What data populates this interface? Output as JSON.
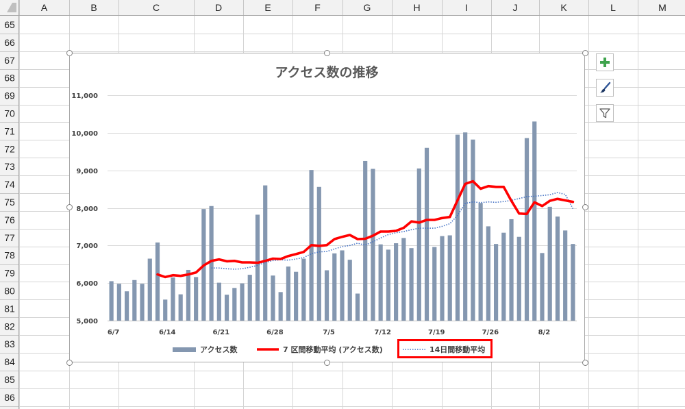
{
  "columns": [
    "A",
    "B",
    "C",
    "D",
    "E",
    "F",
    "G",
    "H",
    "I",
    "J",
    "K",
    "L",
    "M"
  ],
  "rows": [
    "65",
    "66",
    "67",
    "68",
    "69",
    "70",
    "71",
    "72",
    "73",
    "74",
    "75",
    "76",
    "77",
    "78",
    "79",
    "80",
    "81",
    "82",
    "83",
    "84",
    "85",
    "86"
  ],
  "side_buttons": [
    {
      "name": "chart-elements-button",
      "icon": "plus-icon",
      "color": "#3fa34d"
    },
    {
      "name": "chart-styles-button",
      "icon": "paintbrush-icon",
      "color": "#2f5597"
    },
    {
      "name": "chart-filters-button",
      "icon": "funnel-icon",
      "color": "#595959"
    }
  ],
  "chart_data": {
    "type": "bar",
    "title": "アクセス数の推移",
    "ylim": [
      5000,
      11000
    ],
    "yticks": [
      "5,000",
      "6,000",
      "7,000",
      "8,000",
      "9,000",
      "10,000",
      "11,000"
    ],
    "xtick_labels": [
      "6/7",
      "6/14",
      "6/21",
      "6/28",
      "7/5",
      "7/12",
      "7/19",
      "7/26",
      "8/2"
    ],
    "grid": true,
    "legend_position": "bottom",
    "colors": {
      "bars": "#8497b0",
      "ma7": "#ff0000",
      "ma14": "#4472c4",
      "highlight": "#ff0000"
    },
    "series": [
      {
        "name": "アクセス数",
        "type": "bar",
        "values": [
          6050,
          5980,
          5780,
          6080,
          5980,
          6650,
          7080,
          5560,
          6150,
          5700,
          6350,
          6160,
          7970,
          8050,
          6010,
          5690,
          5870,
          5990,
          6220,
          7820,
          8600,
          6200,
          5760,
          6440,
          6300,
          6650,
          9010,
          8560,
          6340,
          6790,
          6870,
          6620,
          5720,
          9250,
          9040,
          7030,
          6890,
          7060,
          7200,
          6930,
          9050,
          9600,
          6960,
          7250,
          7270,
          9950,
          10010,
          9820,
          8130,
          7510,
          7040,
          7340,
          7700,
          7230,
          9860,
          10300,
          6800,
          8030,
          7770,
          7400,
          7040
        ]
      },
      {
        "name": "7 区間移動平均 (アクセス数)",
        "type": "line",
        "style": "solid",
        "values": [
          null,
          null,
          null,
          null,
          null,
          null,
          6230,
          6160,
          6210,
          6190,
          6230,
          6280,
          6470,
          6590,
          6630,
          6580,
          6590,
          6550,
          6550,
          6540,
          6590,
          6650,
          6640,
          6720,
          6770,
          6830,
          7010,
          6990,
          7010,
          7170,
          7230,
          7280,
          7170,
          7180,
          7260,
          7370,
          7370,
          7390,
          7470,
          7640,
          7610,
          7680,
          7680,
          7730,
          7760,
          8200,
          8640,
          8710,
          8510,
          8580,
          8560,
          8560,
          8190,
          7850,
          7840,
          8150,
          8050,
          8190,
          8240,
          8200,
          8160
        ]
      },
      {
        "name": "14日間移動平均",
        "type": "line",
        "style": "dotted",
        "highlight": true,
        "values": [
          null,
          null,
          null,
          null,
          null,
          null,
          null,
          null,
          null,
          null,
          null,
          null,
          null,
          6400,
          6400,
          6380,
          6370,
          6380,
          6420,
          6470,
          6550,
          6600,
          6620,
          6610,
          6640,
          6680,
          6780,
          6830,
          6840,
          6910,
          6970,
          7000,
          7060,
          7010,
          7100,
          7200,
          7290,
          7340,
          7370,
          7420,
          7460,
          7460,
          7460,
          7510,
          7580,
          7800,
          8120,
          8160,
          8140,
          8160,
          8150,
          8170,
          8200,
          8250,
          8300,
          8310,
          8330,
          8350,
          8410,
          8360,
          7980
        ]
      }
    ]
  }
}
